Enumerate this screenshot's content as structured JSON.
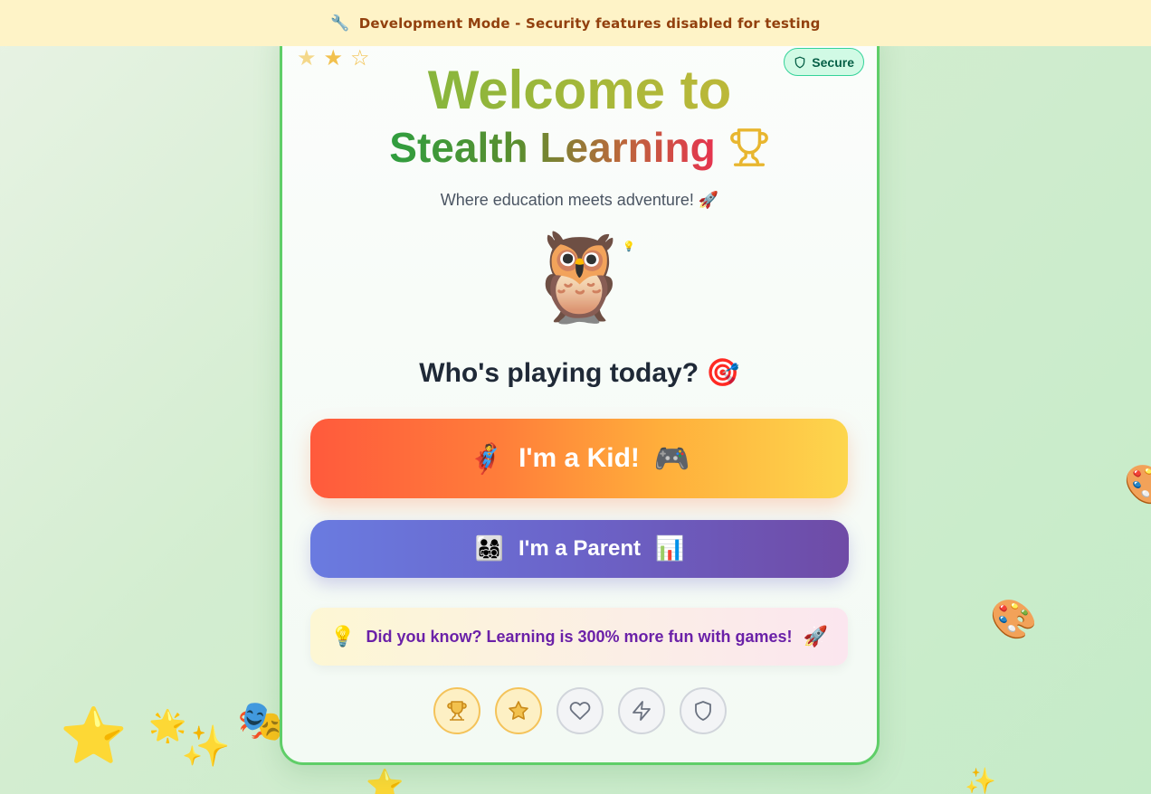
{
  "banner": {
    "icon": "wrench-icon",
    "text": "Development Mode - Security features disabled for testing"
  },
  "decorations": [
    {
      "name": "ring-deco",
      "glyph": "⭐"
    },
    {
      "name": "sparkle-deco",
      "glyph": "✨"
    },
    {
      "name": "burst-deco",
      "glyph": "🌟"
    },
    {
      "name": "theater-deco",
      "glyph": "🎭"
    },
    {
      "name": "palette-deco",
      "glyph": "🎨"
    },
    {
      "name": "palette-edge-deco",
      "glyph": "🎨"
    },
    {
      "name": "sparkle-bottom-deco",
      "glyph": "✨"
    },
    {
      "name": "star-bottom-deco",
      "glyph": "⭐"
    }
  ],
  "stars": [
    "star-faded",
    "star-gold",
    "star-outline"
  ],
  "secure_badge": {
    "icon": "shield-icon",
    "label": "Secure"
  },
  "title": {
    "line1": "Welcome to",
    "line2": "Stealth Learning",
    "icon": "trophy-icon"
  },
  "subtitle": "Where education meets adventure! 🚀",
  "mascot": {
    "glyph": "🦉",
    "accent": "💡"
  },
  "question": "Who's playing today? 🎯",
  "kid_button": {
    "emoji_left": "🦸",
    "label": "I'm a Kid!",
    "emoji_right": "🎮"
  },
  "parent_button": {
    "emoji_left": "👨‍👩‍👧‍👦",
    "label": "I'm a Parent",
    "emoji_right": "📊"
  },
  "fact": {
    "emoji_left": "💡",
    "text": "Did you know? Learning is 300% more fun with games!",
    "emoji_right": "🚀"
  },
  "achievements": [
    {
      "icon": "trophy-icon",
      "unlocked": true
    },
    {
      "icon": "star-icon",
      "unlocked": true
    },
    {
      "icon": "heart-icon",
      "unlocked": false
    },
    {
      "icon": "lightning-icon",
      "unlocked": false
    },
    {
      "icon": "shield-icon",
      "unlocked": false
    }
  ],
  "colors": {
    "banner_bg": "#fef3c7",
    "banner_text": "#92400e",
    "card_border": "#5fce68",
    "secure_bg": "#d1fae5",
    "fact_text": "#6b21a8"
  }
}
